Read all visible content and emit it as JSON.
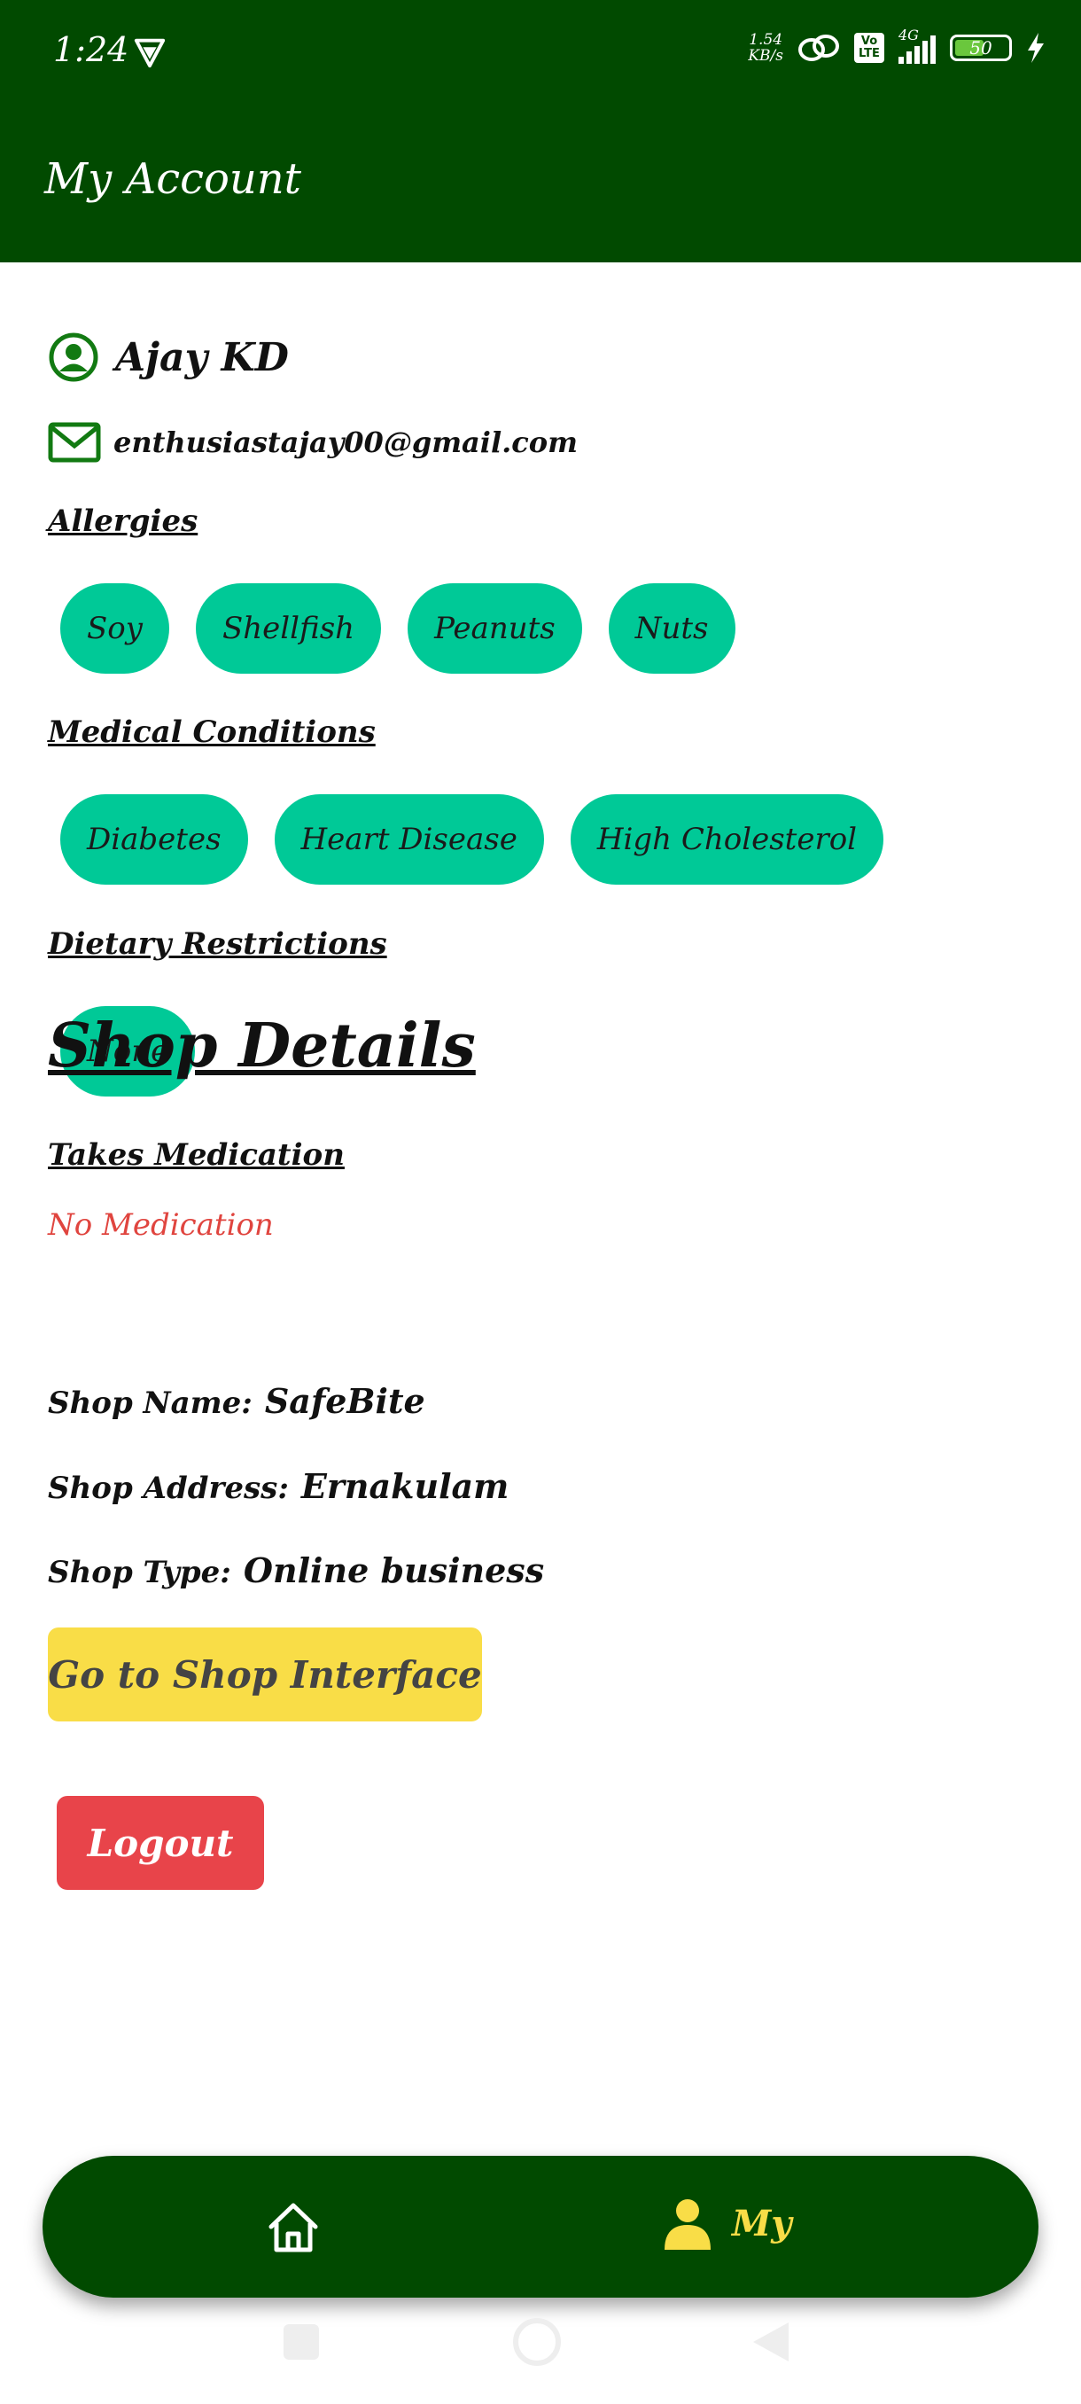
{
  "status_bar": {
    "time": "1:24",
    "speed_value": "1.54",
    "speed_unit": "KB/s",
    "volte_line1": "Vo",
    "volte_line2": "LTE",
    "network": "4G",
    "battery_level": "50"
  },
  "header": {
    "title": "My Account"
  },
  "profile": {
    "name": "Ajay KD",
    "email": "enthusiastajay00@gmail.com"
  },
  "allergies": {
    "label": "Allergies",
    "items": [
      "Soy",
      "Shellfish",
      "Peanuts",
      "Nuts"
    ]
  },
  "medical_conditions": {
    "label": "Medical Conditions",
    "items": [
      "Diabetes",
      "Heart Disease",
      "High Cholesterol"
    ]
  },
  "dietary_restrictions": {
    "label": "Dietary Restrictions",
    "items": [
      "None"
    ]
  },
  "medication": {
    "label": "Takes Medication",
    "value": "No Medication"
  },
  "shop": {
    "title": "Shop Details",
    "name_label": "Shop Name:",
    "name_value": "SafeBite",
    "address_label": "Shop Address:",
    "address_value": "Ernakulam",
    "type_label": "Shop Type:",
    "type_value": "Online business"
  },
  "buttons": {
    "shop_interface": "Go to Shop Interface",
    "logout": "Logout"
  },
  "bottom_nav": {
    "home_icon": "home-icon",
    "my_label": "My"
  },
  "colors": {
    "header_bg": "#014a00",
    "chip_bg": "#00c997",
    "shop_button": "#f9dd47",
    "logout_button": "#e8444a",
    "no_medication_text": "#e0453f"
  }
}
